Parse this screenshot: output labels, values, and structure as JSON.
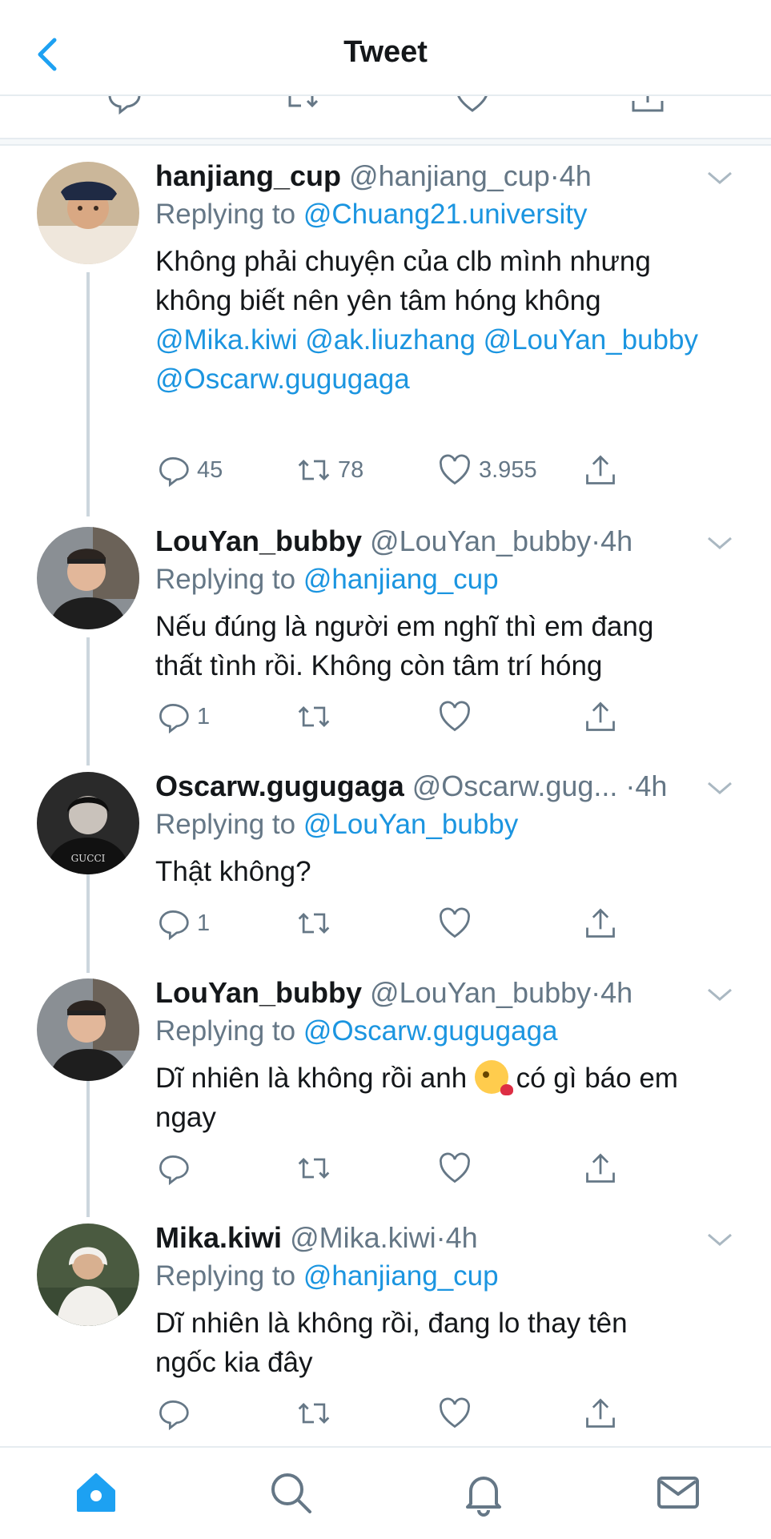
{
  "header": {
    "title": "Tweet"
  },
  "tweets": [
    {
      "name": "hanjiang_cup",
      "handle": "@hanjiang_cup",
      "sep": "·",
      "time": "4h",
      "reply_label": "Replying to",
      "reply_to": "@Chuang21.university",
      "lines": [
        [
          {
            "t": "Không phải chuyện của clb mình nhưng"
          }
        ],
        [
          {
            "t": "không biết nên yên tâm hóng không"
          }
        ],
        [
          {
            "t": "@Mika.kiwi",
            "m": true
          },
          {
            "t": " "
          },
          {
            "t": "@ak.liuzhang",
            "m": true
          },
          {
            "t": " "
          },
          {
            "t": "@LouYan_bubby",
            "m": true
          }
        ],
        [
          {
            "t": "@Oscarw.gugugaga",
            "m": true
          }
        ]
      ],
      "replies": "45",
      "retweets": "78",
      "likes": "3.955"
    },
    {
      "name": "LouYan_bubby",
      "handle": "@LouYan_bubby",
      "sep": "·",
      "time": "4h",
      "reply_label": "Replying to",
      "reply_to": "@hanjiang_cup",
      "lines": [
        [
          {
            "t": "Nếu đúng là người em nghĩ thì em đang"
          }
        ],
        [
          {
            "t": "thất tình rồi. Không còn tâm trí hóng"
          }
        ]
      ],
      "replies": "1",
      "retweets": "",
      "likes": ""
    },
    {
      "name": "Oscarw.gugugaga",
      "handle": "@Oscarw.gug...",
      "sep": " ·",
      "time": "4h",
      "reply_label": "Replying to",
      "reply_to": "@LouYan_bubby",
      "lines": [
        [
          {
            "t": "Thật không?"
          }
        ]
      ],
      "replies": "1",
      "retweets": "",
      "likes": ""
    },
    {
      "name": "LouYan_bubby",
      "handle": "@LouYan_bubby",
      "sep": "·",
      "time": "4h",
      "reply_label": "Replying to",
      "reply_to": "@Oscarw.gugugaga",
      "lines": [
        [
          {
            "t": "Dĩ nhiên là không rồi anh "
          },
          {
            "emoji": "kissing-face-emoji"
          },
          {
            "t": " có gì báo em"
          }
        ],
        [
          {
            "t": "ngay"
          }
        ]
      ],
      "replies": "",
      "retweets": "",
      "likes": ""
    },
    {
      "name": "Mika.kiwi",
      "handle": "@Mika.kiwi",
      "sep": "·",
      "time": "4h",
      "reply_label": "Replying to",
      "reply_to": "@hanjiang_cup",
      "lines": [
        [
          {
            "t": "Dĩ nhiên là không rồi, đang lo thay tên"
          }
        ],
        [
          {
            "t": "ngốc kia đây"
          }
        ]
      ],
      "replies": "",
      "retweets": "",
      "likes": ""
    }
  ],
  "tabs": [
    "home-icon",
    "search-icon",
    "notifications-icon",
    "messages-icon"
  ],
  "colors": {
    "accent": "#1da1f2",
    "link": "#1b95e0",
    "muted": "#657786",
    "divider": "#e6ecf0",
    "thread": "#ccd6dd"
  }
}
